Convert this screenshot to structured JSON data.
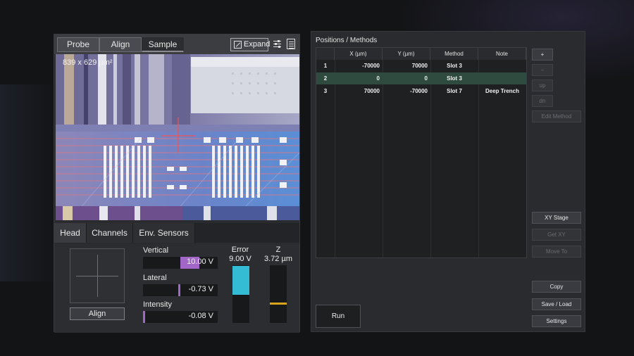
{
  "view_toolbar": {
    "tabs": [
      "Probe",
      "Align",
      "Sample"
    ],
    "active_tab": "Sample",
    "expand_label": "Expand"
  },
  "camera": {
    "scan_size": "839 x 629 µm²"
  },
  "head_tabs": {
    "tabs": [
      "Head",
      "Channels",
      "Env. Sensors"
    ],
    "active_tab": "Head"
  },
  "head": {
    "align_button": "Align",
    "vertical": {
      "label": "Vertical",
      "value": "10.00 V",
      "level": 0.5,
      "color": "#a266c9"
    },
    "lateral": {
      "label": "Lateral",
      "value": "-0.73 V",
      "level": -0.05,
      "color": "#a266c9"
    },
    "intensity": {
      "label": "Intensity",
      "value": "-0.08 V",
      "level": 0.0,
      "color": "#a266c9"
    },
    "error": {
      "title": "Error",
      "value": "9.00 V",
      "level": 0.5,
      "color": "#33bcd4"
    },
    "z": {
      "title": "Z",
      "value": "3.72 µm",
      "level": 0.5,
      "color": "#d9a31c"
    }
  },
  "positions": {
    "title": "Positions / Methods",
    "columns": [
      "",
      "X (µm)",
      "Y (µm)",
      "Method",
      "Note"
    ],
    "rows": [
      {
        "num": "1",
        "x": "-70000",
        "y": "70000",
        "method": "Slot 3",
        "note": ""
      },
      {
        "num": "2",
        "x": "0",
        "y": "0",
        "method": "Slot 3",
        "note": ""
      },
      {
        "num": "3",
        "x": "70000",
        "y": "-70000",
        "method": "Slot 7",
        "note": "Deep Trench"
      }
    ],
    "selected_row": 2
  },
  "side_buttons": {
    "add": "+",
    "remove": "–",
    "up": "up",
    "down": "dn",
    "edit_method": "Edit Method",
    "xy_stage": "XY Stage",
    "get_xy": "Get XY",
    "move_to": "Move To",
    "copy": "Copy",
    "save_load": "Save / Load",
    "settings": "Settings"
  },
  "run_button": "Run"
}
